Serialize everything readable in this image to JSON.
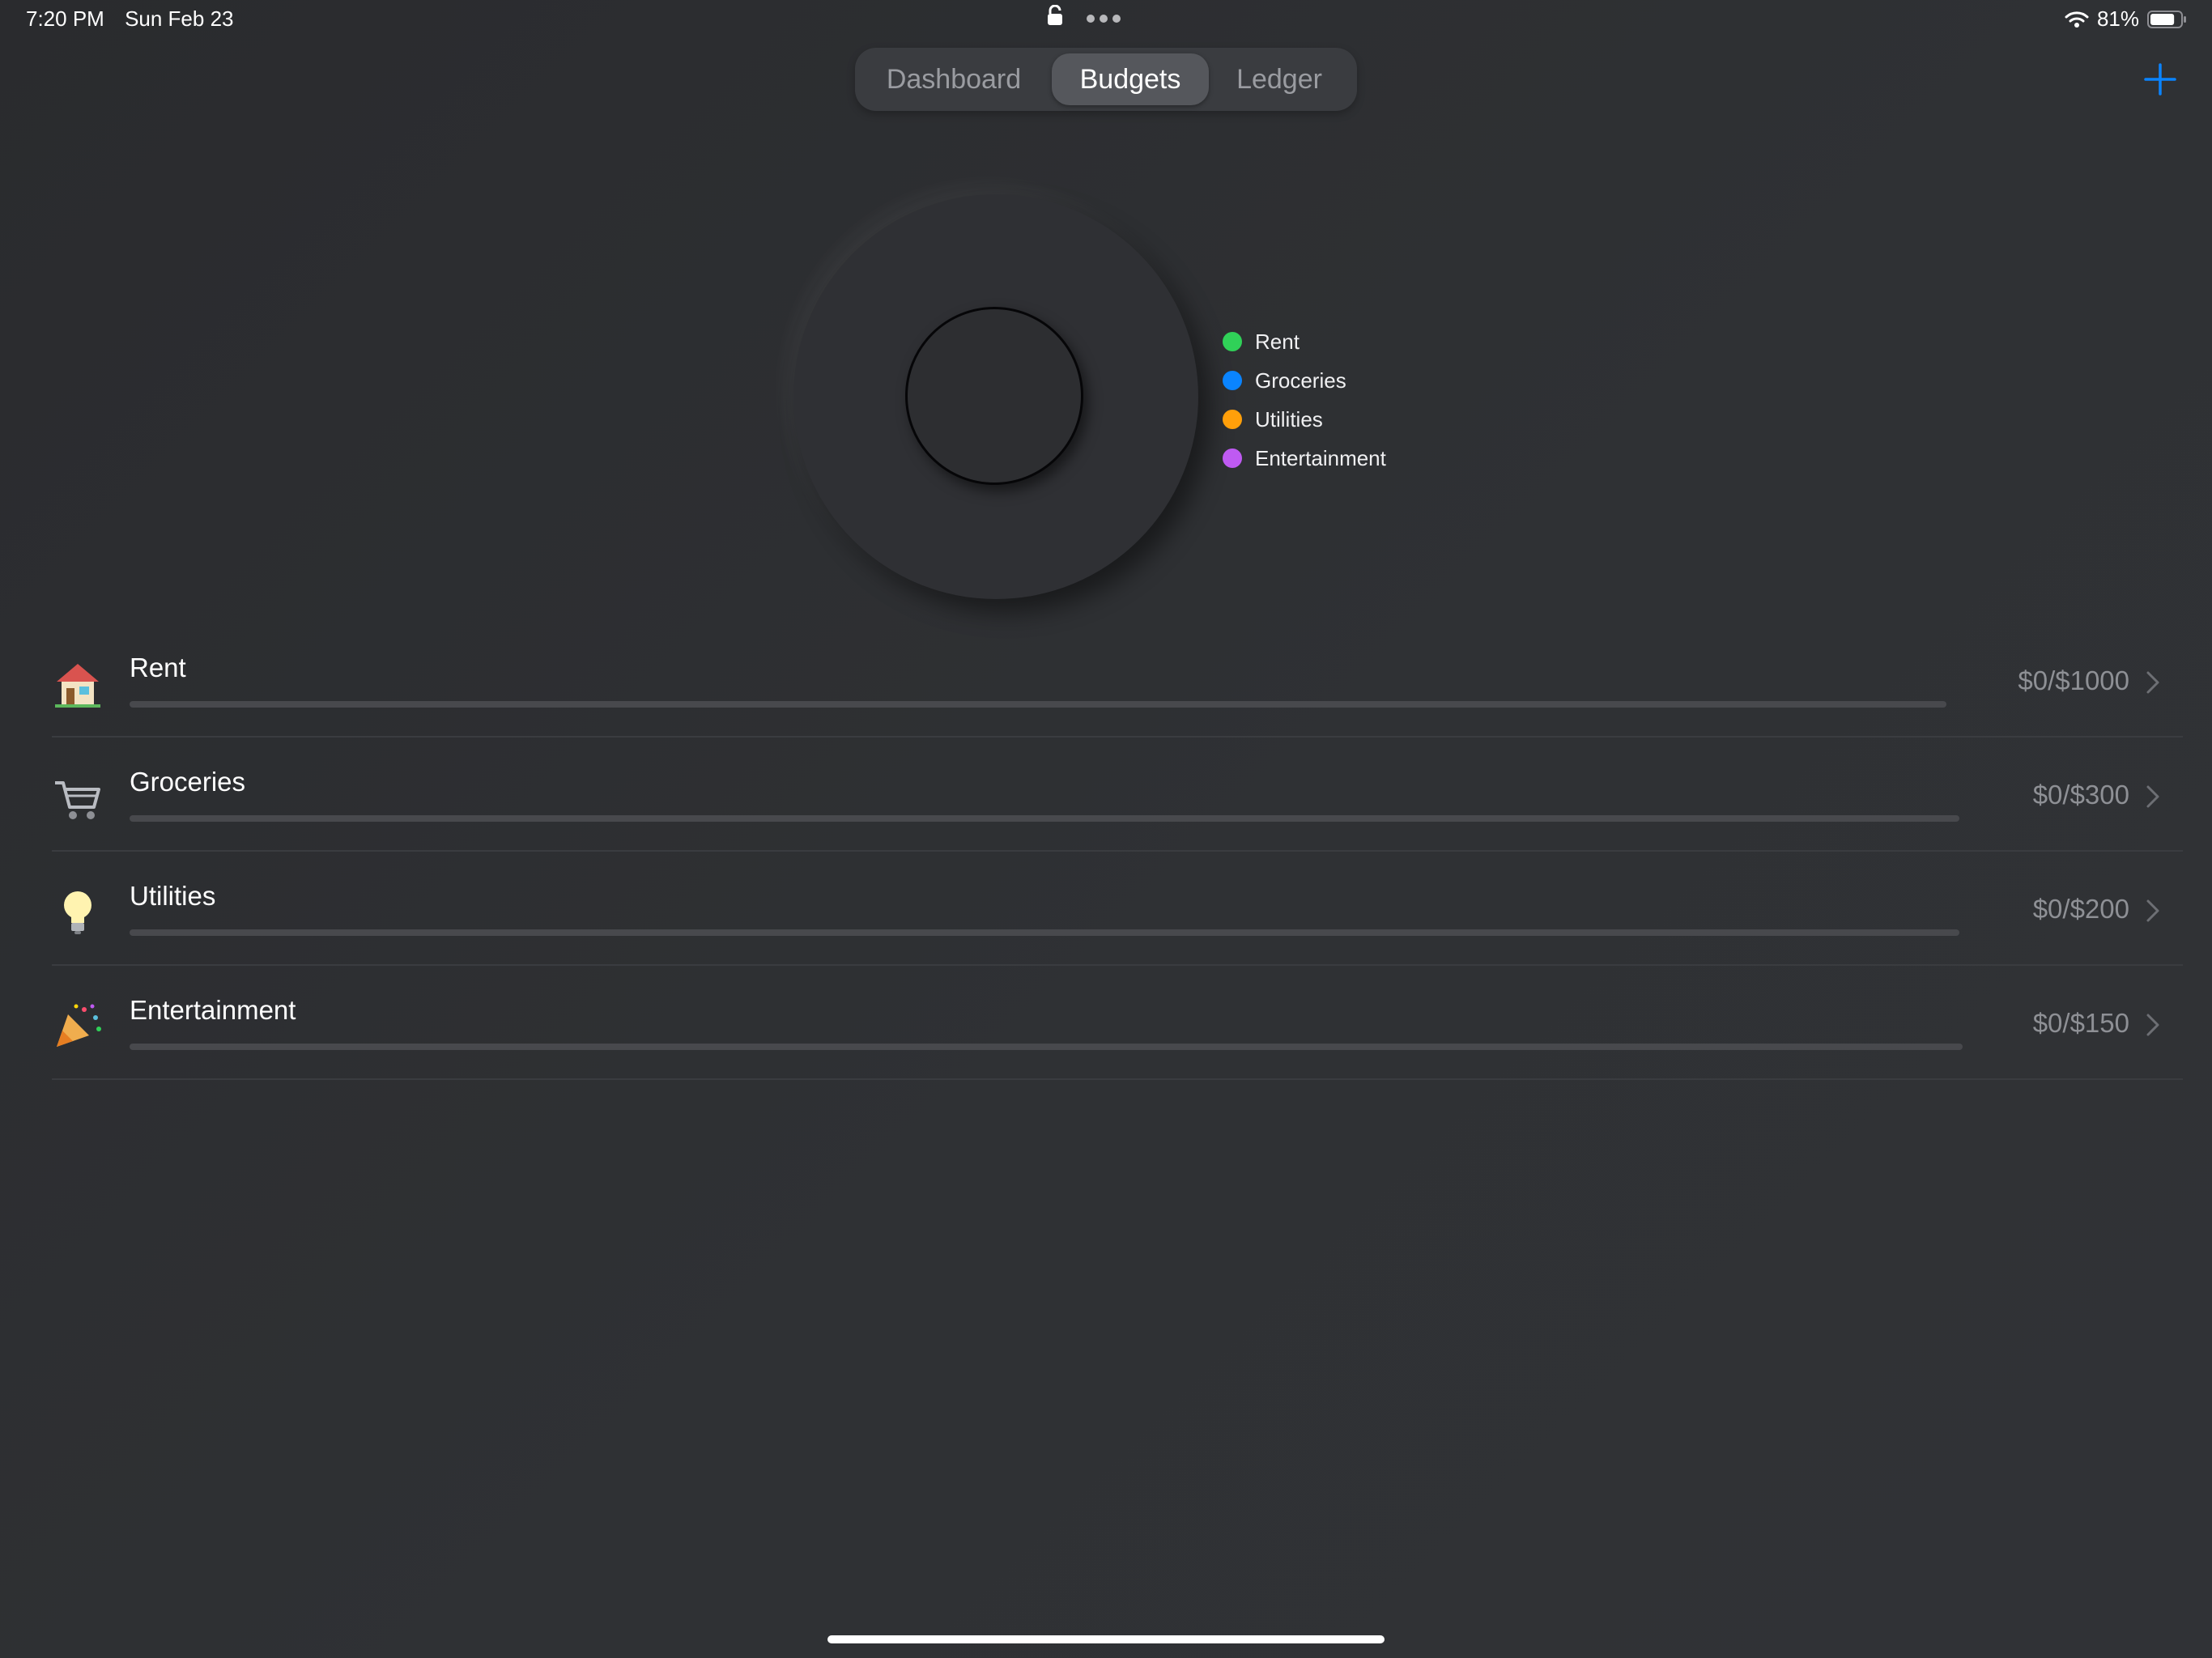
{
  "status_bar": {
    "time": "7:20 PM",
    "date": "Sun Feb 23",
    "battery": "81%",
    "battery_level": 0.81
  },
  "tabs": [
    {
      "label": "Dashboard",
      "active": false
    },
    {
      "label": "Budgets",
      "active": true
    },
    {
      "label": "Ledger",
      "active": false
    }
  ],
  "colors": {
    "accent": "#0a84ff",
    "rent": "#30d158",
    "groceries": "#0a84ff",
    "utilities": "#ff9f0a",
    "entertainment": "#bf5af2"
  },
  "legend": [
    {
      "label": "Rent",
      "color": "#30d158"
    },
    {
      "label": "Groceries",
      "color": "#0a84ff"
    },
    {
      "label": "Utilities",
      "color": "#ff9f0a"
    },
    {
      "label": "Entertainment",
      "color": "#bf5af2"
    }
  ],
  "budgets": [
    {
      "name": "Rent",
      "icon": "house-icon",
      "amount": "$0/$1000",
      "spent": 0,
      "limit": 1000
    },
    {
      "name": "Groceries",
      "icon": "shopping-cart-icon",
      "amount": "$0/$300",
      "spent": 0,
      "limit": 300
    },
    {
      "name": "Utilities",
      "icon": "light-bulb-icon",
      "amount": "$0/$200",
      "spent": 0,
      "limit": 200
    },
    {
      "name": "Entertainment",
      "icon": "party-popper-icon",
      "amount": "$0/$150",
      "spent": 0,
      "limit": 150
    }
  ]
}
